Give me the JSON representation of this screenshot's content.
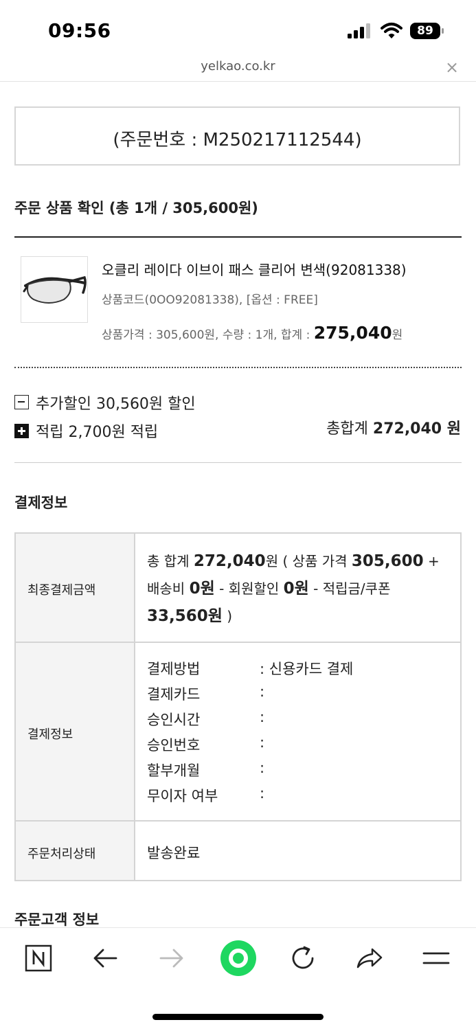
{
  "status_bar": {
    "time": "09:56",
    "battery": "89"
  },
  "browser": {
    "url": "yelkao.co.kr",
    "close": "×"
  },
  "order": {
    "number_text": "(주문번호 : M250217112544)"
  },
  "product_section": {
    "title": "주문 상품 확인 (총 1개 / 305,600원)"
  },
  "product": {
    "name": "오클리 레이다 이브이 패스 클리어 변색(92081338)",
    "code_option": "상품코드(0OO92081338),  [옵션 : FREE]",
    "price_prefix": "상품가격 : 305,600원,  수량 : 1개,  합계 : ",
    "subtotal": "275,040",
    "subtotal_unit": "원"
  },
  "discounts": {
    "extra": "추가할인 30,560원 할인",
    "points": "적립 2,700원 적립",
    "total_label": "총합계 ",
    "total_value": "272,040 원"
  },
  "payment_section": {
    "title": "결제정보"
  },
  "payment_table": {
    "final_label": "최종결제금액",
    "final": {
      "t1": "총 합계 ",
      "b1": "272,040",
      "t2": "원 ( 상품 가격 ",
      "b2": "305,600",
      "t3": " +",
      "t4": "배송비 ",
      "b3": "0원",
      "t5": " - 회원할인 ",
      "b4": "0원",
      "t6": " - 적립금/쿠폰",
      "b5": "33,560원",
      "t7": " )"
    },
    "info_label": "결제정보",
    "info_rows": [
      {
        "key": "결제방법",
        "value": ": 신용카드 결제"
      },
      {
        "key": "결제카드",
        "value": ":"
      },
      {
        "key": "승인시간",
        "value": ":"
      },
      {
        "key": "승인번호",
        "value": ":"
      },
      {
        "key": "할부개월",
        "value": ":"
      },
      {
        "key": "무이자 여부",
        "value": ":"
      }
    ],
    "status_label": "주문처리상태",
    "status_value": "발송완료"
  },
  "customer_section": {
    "title": "주문고객 정보"
  },
  "toolbar": {
    "icons": [
      "naver-home-icon",
      "back-arrow-icon",
      "forward-arrow-icon",
      "green-dot-icon",
      "reload-icon",
      "share-icon",
      "menu-icon"
    ],
    "accent": "#1ed760"
  }
}
